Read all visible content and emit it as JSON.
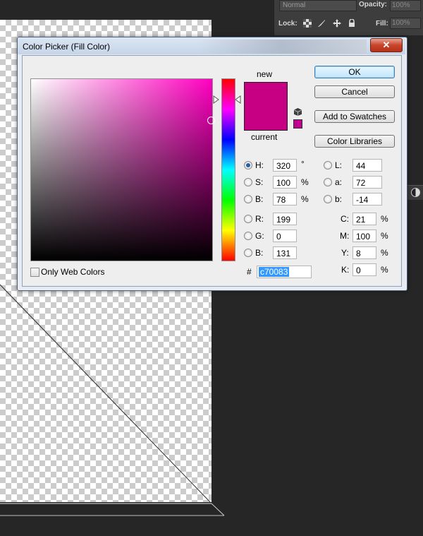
{
  "ps_options": {
    "blend_mode": "Normal",
    "opacity_label": "Opacity:",
    "opacity_value": "100%",
    "lock_label": "Lock:",
    "fill_label": "Fill:",
    "fill_value": "100%",
    "lock_icons": [
      "checker-lock-icon",
      "brush-lock-icon",
      "move-lock-icon",
      "padlock-icon"
    ]
  },
  "dialog": {
    "title": "Color Picker (Fill Color)",
    "close_glyph": "✕",
    "new_label": "new",
    "current_label": "current",
    "new_color": "#c70083",
    "current_color": "#c70083",
    "websafe_color": "#c0008c",
    "buttons": {
      "ok": "OK",
      "cancel": "Cancel",
      "add_swatches": "Add to Swatches",
      "color_libraries": "Color Libraries"
    },
    "hsb": [
      {
        "label": "H:",
        "value": "320",
        "unit": "°",
        "selected": true
      },
      {
        "label": "S:",
        "value": "100",
        "unit": "%",
        "selected": false
      },
      {
        "label": "B:",
        "value": "78",
        "unit": "%",
        "selected": false
      }
    ],
    "rgb": [
      {
        "label": "R:",
        "value": "199"
      },
      {
        "label": "G:",
        "value": "0"
      },
      {
        "label": "B:",
        "value": "131"
      }
    ],
    "lab": [
      {
        "label": "L:",
        "value": "44"
      },
      {
        "label": "a:",
        "value": "72"
      },
      {
        "label": "b:",
        "value": "-14"
      }
    ],
    "cmyk": [
      {
        "label": "C:",
        "value": "21",
        "unit": "%"
      },
      {
        "label": "M:",
        "value": "100",
        "unit": "%"
      },
      {
        "label": "Y:",
        "value": "8",
        "unit": "%"
      },
      {
        "label": "K:",
        "value": "0",
        "unit": "%"
      }
    ],
    "hex_label": "#",
    "hex_value": "c70083",
    "web_colors_label": "Only Web Colors",
    "web_colors_checked": false,
    "hue_color": "#ff00c0"
  }
}
